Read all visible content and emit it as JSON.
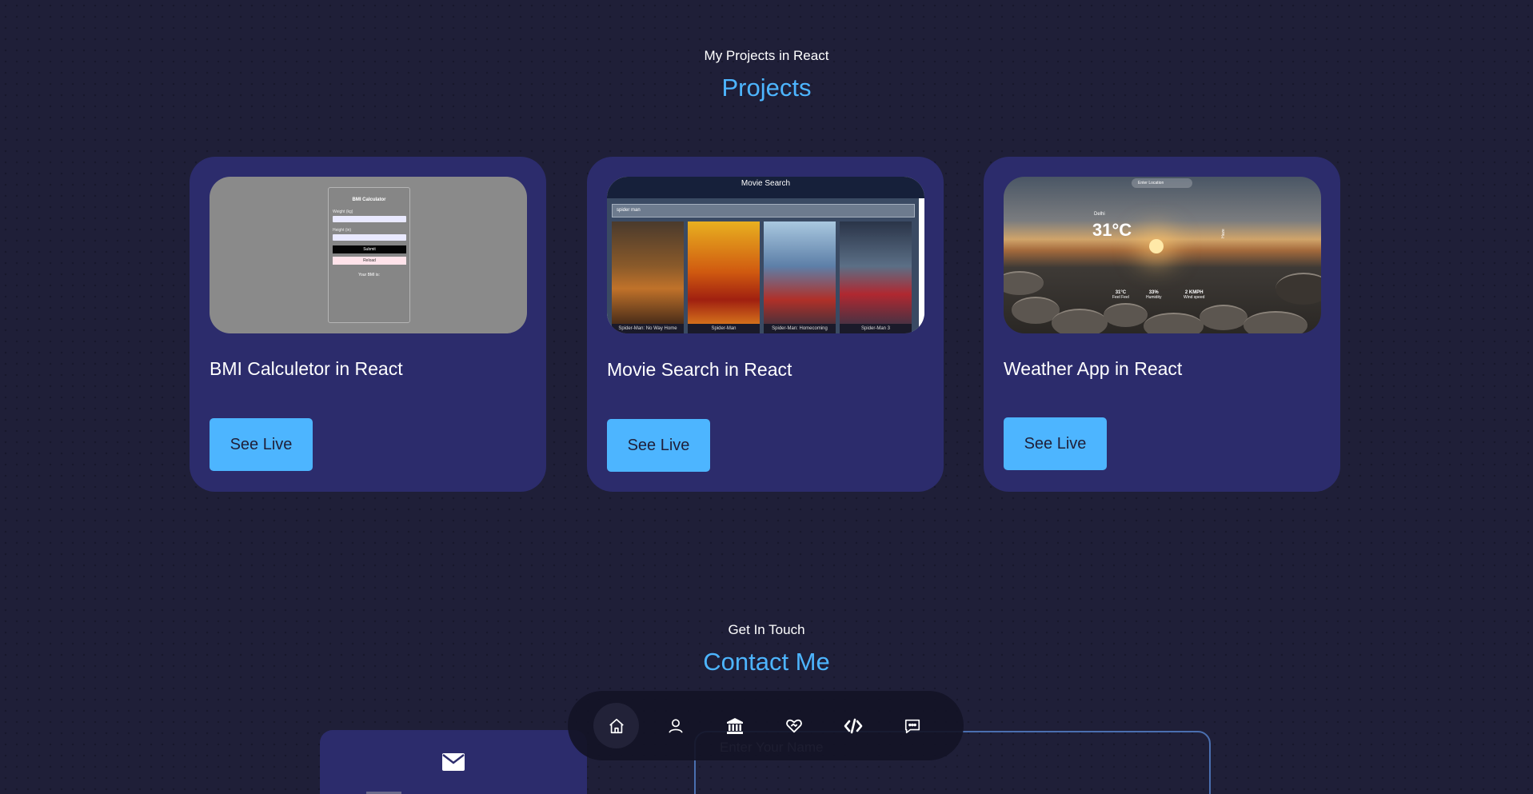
{
  "projects_section": {
    "subtitle": "My Projects in React",
    "title": "Projects"
  },
  "projects": [
    {
      "title": "BMI Calculetor in React",
      "button": "See Live",
      "thumbnail": {
        "heading": "BMI Calculator",
        "weight_label": "Weight (kg)",
        "height_label": "Height (in)",
        "submit": "Submit",
        "reload": "Reload",
        "result": "Your BMI is:"
      }
    },
    {
      "title": "Movie Search in React",
      "button": "See Live",
      "thumbnail": {
        "heading": "Movie Search",
        "search_value": "spider man",
        "posters": [
          {
            "caption": "Spider-Man: No Way Home",
            "color": "#3a2a1c"
          },
          {
            "caption": "Spider-Man",
            "color": "#c9721e"
          },
          {
            "caption": "Spider-Man: Homecoming",
            "color": "#5d7fa8"
          },
          {
            "caption": "Spider-Man 3",
            "color": "#5b6f86"
          }
        ]
      }
    },
    {
      "title": "Weather App in React",
      "button": "See Live",
      "thumbnail": {
        "search_placeholder": "Enter Location",
        "city": "Delhi",
        "temperature": "31°C",
        "condition": "Haze",
        "stats": [
          {
            "value": "31°C",
            "label": "Feel Feel"
          },
          {
            "value": "33%",
            "label": "Humidity"
          },
          {
            "value": "2 KMPH",
            "label": "Wind speed"
          }
        ]
      }
    }
  ],
  "contact_section": {
    "subtitle": "Get In Touch",
    "title": "Contact Me",
    "name_placeholder": "Enter Your Name"
  },
  "nav": {
    "active": "home",
    "items": [
      "home-icon",
      "user-icon",
      "bank-icon",
      "heart-handshake-icon",
      "code-icon",
      "message-icon"
    ]
  },
  "colors": {
    "background": "#1f1f38",
    "card": "#2c2c6c",
    "accent": "#4db5ff"
  }
}
